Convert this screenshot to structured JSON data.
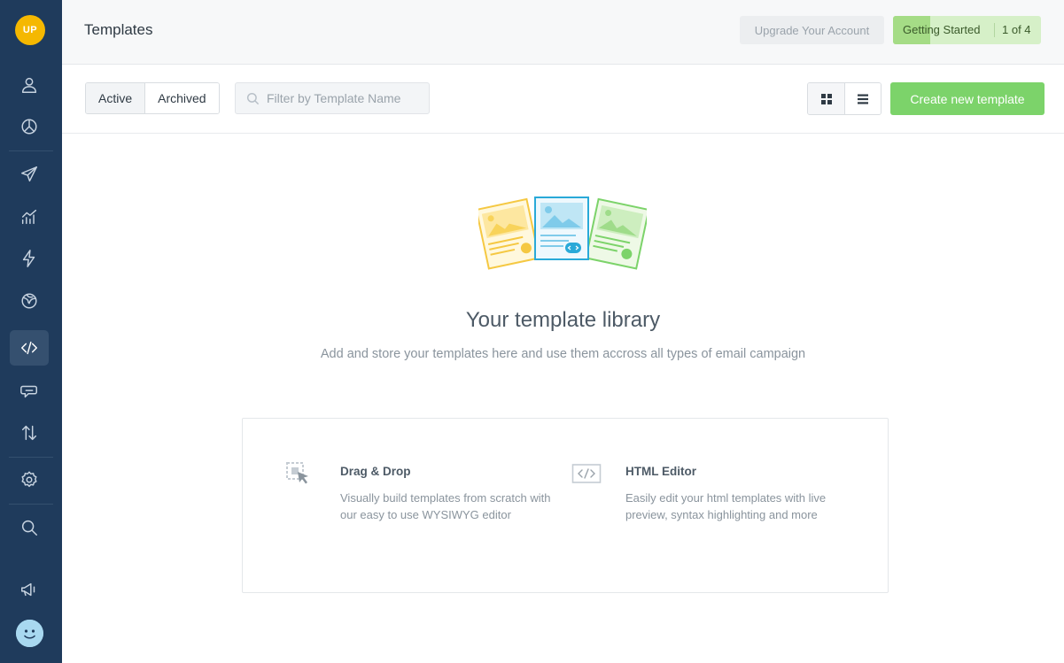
{
  "sidebar": {
    "logo_text": "UP",
    "items": [
      {
        "name": "contacts",
        "icon": "user-icon"
      },
      {
        "name": "segments",
        "icon": "pie-chart-icon"
      },
      {
        "name": "campaigns",
        "icon": "paper-plane-icon"
      },
      {
        "name": "reports",
        "icon": "bar-chart-icon"
      },
      {
        "name": "automation",
        "icon": "lightning-icon"
      },
      {
        "name": "web",
        "icon": "globe-icon"
      },
      {
        "name": "templates",
        "icon": "code-icon",
        "active": true
      },
      {
        "name": "conversations",
        "icon": "chat-icon"
      },
      {
        "name": "integrations",
        "icon": "transfer-icon"
      },
      {
        "name": "settings",
        "icon": "gear-icon"
      },
      {
        "name": "search",
        "icon": "search-icon"
      },
      {
        "name": "announcements",
        "icon": "megaphone-icon"
      }
    ]
  },
  "header": {
    "title": "Templates",
    "upgrade_label": "Upgrade Your Account",
    "getting_started_label": "Getting Started",
    "getting_started_progress": "1 of 4",
    "getting_started_fraction": 0.25
  },
  "toolbar": {
    "tabs": [
      {
        "label": "Active",
        "active": true
      },
      {
        "label": "Archived",
        "active": false
      }
    ],
    "filter_placeholder": "Filter by Template Name",
    "filter_value": "",
    "create_label": "Create new template"
  },
  "empty_state": {
    "title": "Your template library",
    "subtitle": "Add and store your templates here and use them accross all types of email campaign"
  },
  "options": [
    {
      "title": "Drag & Drop",
      "description": "Visually build templates from scratch with our easy to use WYSIWYG editor",
      "icon": "drag-drop-icon"
    },
    {
      "title": "HTML Editor",
      "description": "Easily edit your html templates with live preview, syntax highlighting and more",
      "icon": "html-code-icon"
    }
  ],
  "colors": {
    "sidebar_bg": "#1f3b5c",
    "accent_green": "#7cd36a",
    "logo_yellow": "#f5b800"
  }
}
